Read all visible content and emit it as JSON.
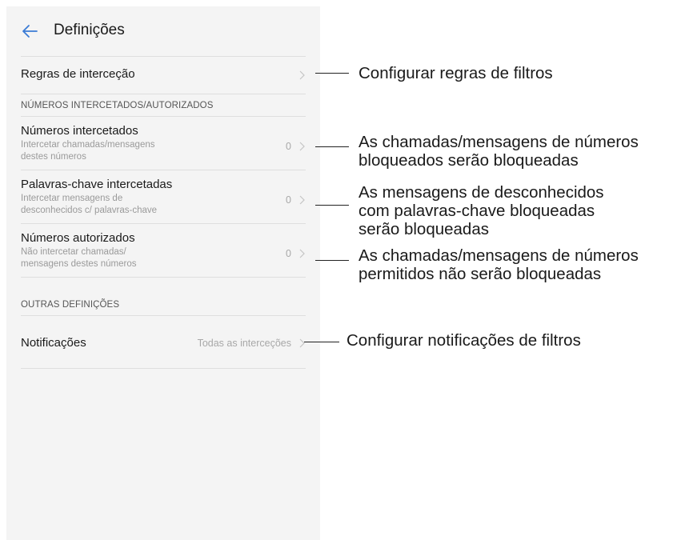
{
  "header": {
    "title": "Definições"
  },
  "rows": {
    "rules": {
      "title": "Regras de interceção"
    },
    "section_blocked": "NÚMEROS INTERCETADOS/AUTORIZADOS",
    "blocked_numbers": {
      "title": "Números intercetados",
      "desc_1": "Intercetar chamadas/mensagens",
      "desc_2": "destes números",
      "count": "0"
    },
    "keywords": {
      "title": "Palavras-chave intercetadas",
      "desc_1": "Intercetar mensagens de",
      "desc_2": "desconhecidos c/ palavras-chave",
      "count": "0"
    },
    "allowed_numbers": {
      "title": "Números autorizados",
      "desc_1": "Não intercetar chamadas/",
      "desc_2": "mensagens destes números",
      "count": "0"
    },
    "section_other": "OUTRAS DEFINIÇÕES",
    "notifications": {
      "title": "Notificações",
      "value": "Todas as interceções"
    }
  },
  "callouts": {
    "rules": [
      "Configurar regras de filtros"
    ],
    "blocked_numbers": [
      "As chamadas/mensagens de números",
      "bloqueados serão bloqueadas"
    ],
    "keywords": [
      "As mensagens de desconhecidos",
      "com palavras-chave bloqueadas",
      "serão bloqueadas"
    ],
    "allowed_numbers": [
      "As chamadas/mensagens de números",
      "permitidos não serão bloqueadas"
    ],
    "notifications": [
      "Configurar notificações de filtros"
    ]
  },
  "icons": {
    "back": "arrow-left-icon",
    "chevron": "chevron-right-icon"
  },
  "colors": {
    "accent": "#3a7bd5",
    "background": "#f4f4f4",
    "secondary_text": "#9a9a9a"
  }
}
